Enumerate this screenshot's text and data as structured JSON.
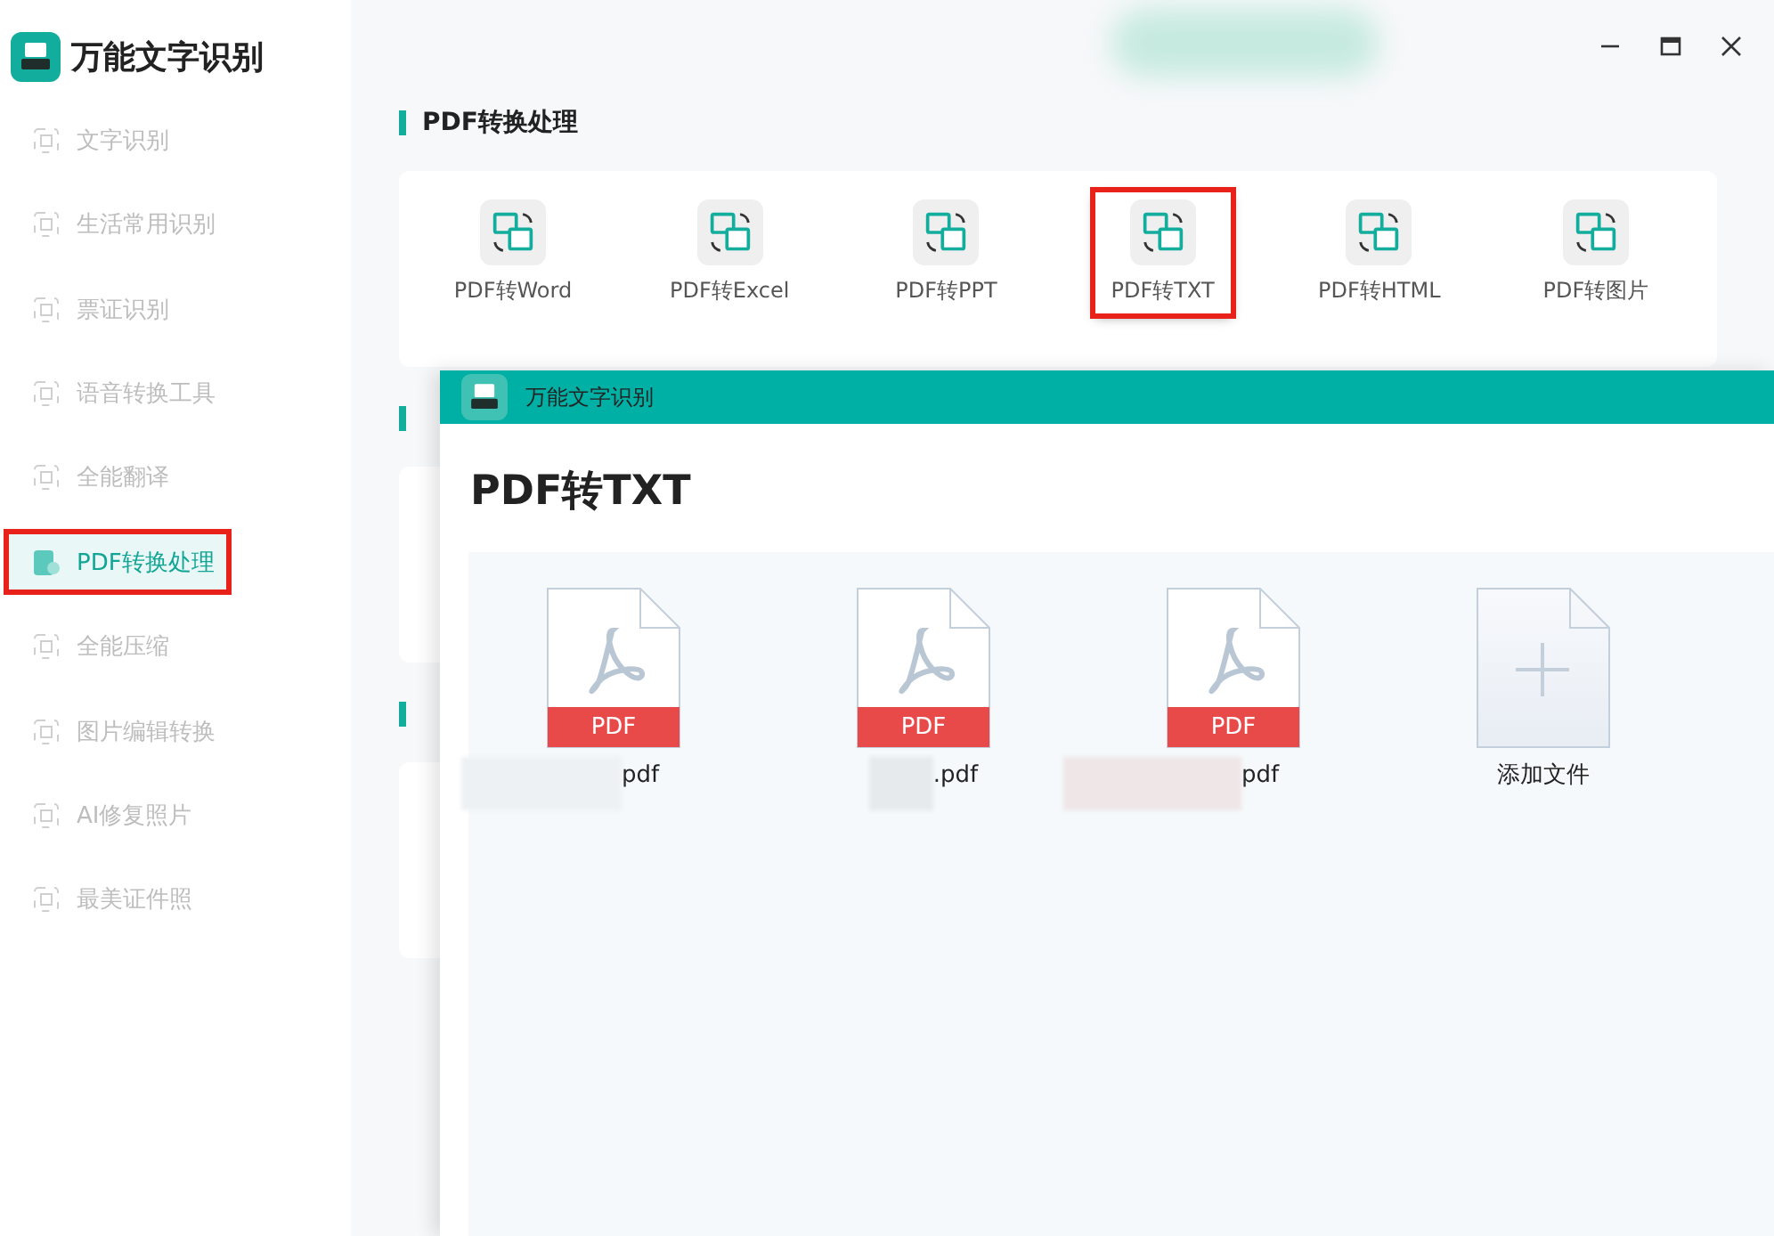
{
  "app": {
    "title": "万能文字识别"
  },
  "sidebar": {
    "items": [
      {
        "label": "文字识别",
        "selected": false
      },
      {
        "label": "生活常用识别",
        "selected": false
      },
      {
        "label": "票证识别",
        "selected": false
      },
      {
        "label": "语音转换工具",
        "selected": false
      },
      {
        "label": "全能翻译",
        "selected": false
      },
      {
        "label": "PDF转换处理",
        "selected": true
      },
      {
        "label": "全能压缩",
        "selected": false
      },
      {
        "label": "图片编辑转换",
        "selected": false
      },
      {
        "label": "AI修复照片",
        "selected": false
      },
      {
        "label": "最美证件照",
        "selected": false
      }
    ]
  },
  "sections": [
    {
      "title": "PDF转换处理",
      "tools": [
        {
          "label": "PDF转Word",
          "highlighted": false
        },
        {
          "label": "PDF转Excel",
          "highlighted": false
        },
        {
          "label": "PDF转PPT",
          "highlighted": false
        },
        {
          "label": "PDF转TXT",
          "highlighted": true
        },
        {
          "label": "PDF转HTML",
          "highlighted": false
        },
        {
          "label": "PDF转图片",
          "highlighted": false
        }
      ]
    }
  ],
  "dialog": {
    "app_title": "万能文字识别",
    "heading": "PDF转TXT",
    "files": [
      {
        "kind": "pdf",
        "badge": "PDF",
        "name": "pdf"
      },
      {
        "kind": "pdf",
        "badge": "PDF",
        "name": ".pdf"
      },
      {
        "kind": "pdf",
        "badge": "PDF",
        "name": "pdf"
      },
      {
        "kind": "add",
        "name": "添加文件"
      }
    ]
  }
}
